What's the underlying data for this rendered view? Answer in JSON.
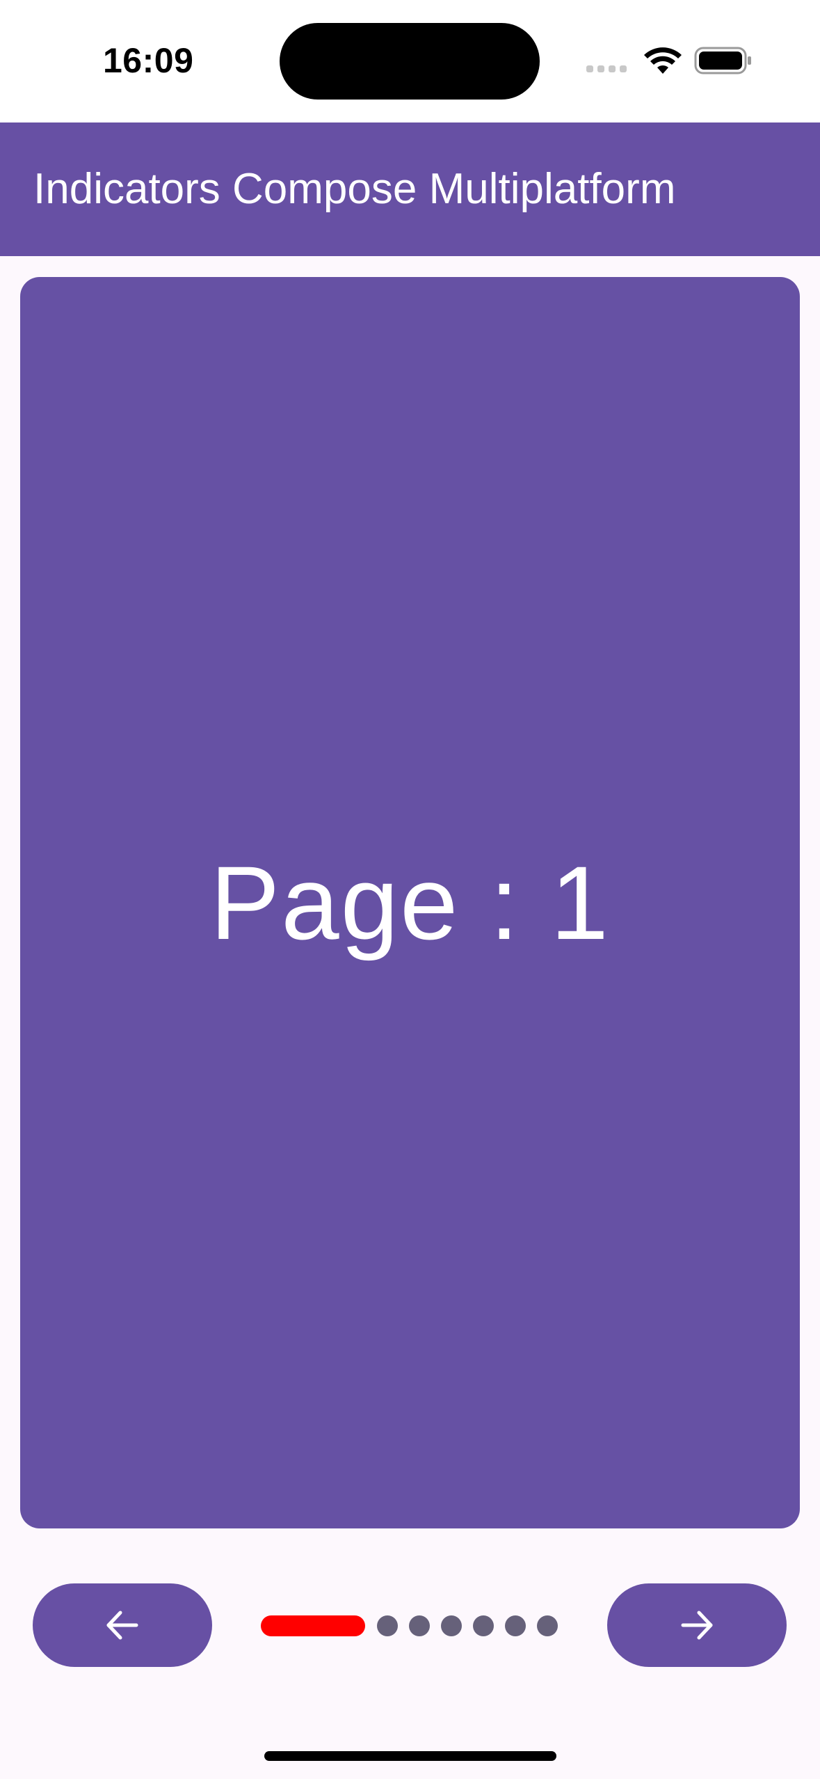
{
  "status_bar": {
    "time": "16:09",
    "icons": [
      "signal-icon",
      "wifi-icon",
      "battery-icon"
    ]
  },
  "app_bar": {
    "title": "Indicators Compose Multiplatform",
    "color": "#6750a4"
  },
  "pager": {
    "page_label": "Page : 1",
    "card_color": "#6651a4"
  },
  "controls": {
    "prev_icon": "arrow-left-icon",
    "next_icon": "arrow-right-icon",
    "indicator": {
      "total": 7,
      "current": 1,
      "active_color": "#ff0000",
      "inactive_color": "#66617a"
    }
  }
}
